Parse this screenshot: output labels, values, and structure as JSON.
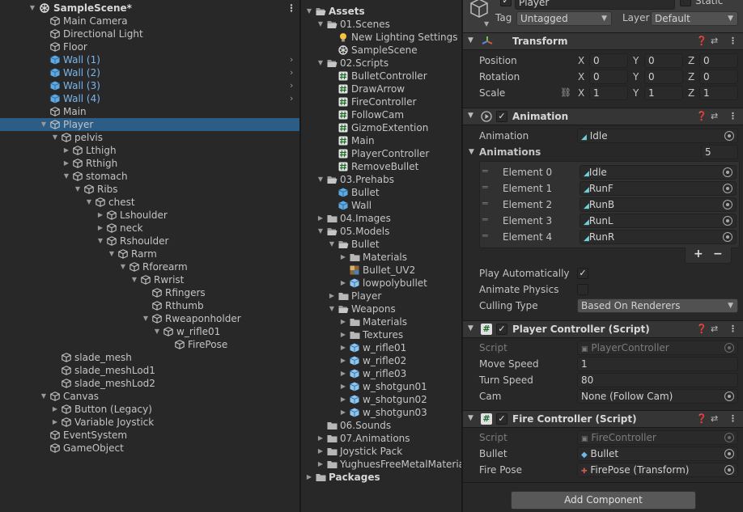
{
  "hierarchy": {
    "scene": "SampleScene*",
    "items": [
      {
        "label": "Main Camera",
        "depth": 1,
        "icon": "gameobject-icon"
      },
      {
        "label": "Directional Light",
        "depth": 1,
        "icon": "gameobject-icon"
      },
      {
        "label": "Floor",
        "depth": 1,
        "icon": "gameobject-icon"
      },
      {
        "label": "Wall (1)",
        "depth": 1,
        "icon": "prefab-icon",
        "prefab": true,
        "chevron": true
      },
      {
        "label": "Wall (2)",
        "depth": 1,
        "icon": "prefab-icon",
        "prefab": true,
        "chevron": true
      },
      {
        "label": "Wall (3)",
        "depth": 1,
        "icon": "prefab-icon",
        "prefab": true,
        "chevron": true
      },
      {
        "label": "Wall (4)",
        "depth": 1,
        "icon": "prefab-icon",
        "prefab": true,
        "chevron": true
      },
      {
        "label": "Main",
        "depth": 1,
        "icon": "gameobject-icon"
      },
      {
        "label": "Player",
        "depth": 1,
        "icon": "gameobject-icon",
        "expanded": true,
        "selected": true
      },
      {
        "label": "pelvis",
        "depth": 2,
        "icon": "gameobject-icon",
        "expanded": true
      },
      {
        "label": "Lthigh",
        "depth": 3,
        "icon": "gameobject-icon",
        "collapsed": true
      },
      {
        "label": "Rthigh",
        "depth": 3,
        "icon": "gameobject-icon",
        "collapsed": true
      },
      {
        "label": "stomach",
        "depth": 3,
        "icon": "gameobject-icon",
        "expanded": true
      },
      {
        "label": "Ribs",
        "depth": 4,
        "icon": "gameobject-icon",
        "expanded": true
      },
      {
        "label": "chest",
        "depth": 5,
        "icon": "gameobject-icon",
        "expanded": true
      },
      {
        "label": "Lshoulder",
        "depth": 6,
        "icon": "gameobject-icon",
        "collapsed": true
      },
      {
        "label": "neck",
        "depth": 6,
        "icon": "gameobject-icon",
        "collapsed": true
      },
      {
        "label": "Rshoulder",
        "depth": 6,
        "icon": "gameobject-icon",
        "expanded": true
      },
      {
        "label": "Rarm",
        "depth": 7,
        "icon": "gameobject-icon",
        "expanded": true
      },
      {
        "label": "Rforearm",
        "depth": 8,
        "icon": "gameobject-icon",
        "expanded": true
      },
      {
        "label": "Rwrist",
        "depth": 9,
        "icon": "gameobject-icon",
        "expanded": true
      },
      {
        "label": "Rfingers",
        "depth": 10,
        "icon": "gameobject-icon"
      },
      {
        "label": "Rthumb",
        "depth": 10,
        "icon": "gameobject-icon"
      },
      {
        "label": "Rweaponholder",
        "depth": 10,
        "icon": "gameobject-icon",
        "expanded": true
      },
      {
        "label": "w_rifle01",
        "depth": 11,
        "icon": "gameobject-icon",
        "expanded": true
      },
      {
        "label": "FirePose",
        "depth": 12,
        "icon": "gameobject-icon"
      },
      {
        "label": "slade_mesh",
        "depth": 2,
        "icon": "gameobject-icon"
      },
      {
        "label": "slade_meshLod1",
        "depth": 2,
        "icon": "gameobject-icon"
      },
      {
        "label": "slade_meshLod2",
        "depth": 2,
        "icon": "gameobject-icon"
      },
      {
        "label": "Canvas",
        "depth": 1,
        "icon": "gameobject-icon",
        "expanded": true
      },
      {
        "label": "Button (Legacy)",
        "depth": 2,
        "icon": "gameobject-icon",
        "collapsed": true
      },
      {
        "label": "Variable Joystick",
        "depth": 2,
        "icon": "gameobject-icon",
        "collapsed": true
      },
      {
        "label": "EventSystem",
        "depth": 1,
        "icon": "gameobject-icon"
      },
      {
        "label": "GameObject",
        "depth": 1,
        "icon": "gameobject-icon"
      }
    ]
  },
  "project": {
    "items": [
      {
        "label": "Assets",
        "depth": 0,
        "icon": "folder-open-icon",
        "expanded": true,
        "bold": true
      },
      {
        "label": "01.Scenes",
        "depth": 1,
        "icon": "folder-open-icon",
        "expanded": true
      },
      {
        "label": "New Lighting Settings",
        "depth": 2,
        "icon": "lighting-icon"
      },
      {
        "label": "SampleScene",
        "depth": 2,
        "icon": "unity-scene-icon"
      },
      {
        "label": "02.Scripts",
        "depth": 1,
        "icon": "folder-open-icon",
        "expanded": true
      },
      {
        "label": "BulletController",
        "depth": 2,
        "icon": "script-icon"
      },
      {
        "label": "DrawArrow",
        "depth": 2,
        "icon": "script-icon"
      },
      {
        "label": "FireController",
        "depth": 2,
        "icon": "script-icon"
      },
      {
        "label": "FollowCam",
        "depth": 2,
        "icon": "script-icon"
      },
      {
        "label": "GizmoExtention",
        "depth": 2,
        "icon": "script-icon"
      },
      {
        "label": "Main",
        "depth": 2,
        "icon": "script-icon"
      },
      {
        "label": "PlayerController",
        "depth": 2,
        "icon": "script-icon"
      },
      {
        "label": "RemoveBullet",
        "depth": 2,
        "icon": "script-icon"
      },
      {
        "label": "03.Prehabs",
        "depth": 1,
        "icon": "folder-open-icon",
        "expanded": true
      },
      {
        "label": "Bullet",
        "depth": 2,
        "icon": "prefab-icon"
      },
      {
        "label": "Wall",
        "depth": 2,
        "icon": "prefab-icon"
      },
      {
        "label": "04.Images",
        "depth": 1,
        "icon": "folder-icon",
        "collapsed": true
      },
      {
        "label": "05.Models",
        "depth": 1,
        "icon": "folder-open-icon",
        "expanded": true
      },
      {
        "label": "Bullet",
        "depth": 2,
        "icon": "folder-open-icon",
        "expanded": true
      },
      {
        "label": "Materials",
        "depth": 3,
        "icon": "folder-icon",
        "collapsed": true
      },
      {
        "label": "Bullet_UV2",
        "depth": 3,
        "icon": "texture-icon"
      },
      {
        "label": "lowpolybullet",
        "depth": 3,
        "icon": "model-icon",
        "collapsed": true
      },
      {
        "label": "Player",
        "depth": 2,
        "icon": "folder-icon",
        "collapsed": true
      },
      {
        "label": "Weapons",
        "depth": 2,
        "icon": "folder-open-icon",
        "expanded": true
      },
      {
        "label": "Materials",
        "depth": 3,
        "icon": "folder-icon",
        "collapsed": true
      },
      {
        "label": "Textures",
        "depth": 3,
        "icon": "folder-icon",
        "collapsed": true
      },
      {
        "label": "w_rifle01",
        "depth": 3,
        "icon": "model-icon",
        "collapsed": true
      },
      {
        "label": "w_rifle02",
        "depth": 3,
        "icon": "model-icon",
        "collapsed": true
      },
      {
        "label": "w_rifle03",
        "depth": 3,
        "icon": "model-icon",
        "collapsed": true
      },
      {
        "label": "w_shotgun01",
        "depth": 3,
        "icon": "model-icon",
        "collapsed": true
      },
      {
        "label": "w_shotgun02",
        "depth": 3,
        "icon": "model-icon",
        "collapsed": true
      },
      {
        "label": "w_shotgun03",
        "depth": 3,
        "icon": "model-icon",
        "collapsed": true
      },
      {
        "label": "06.Sounds",
        "depth": 1,
        "icon": "folder-icon"
      },
      {
        "label": "07.Animations",
        "depth": 1,
        "icon": "folder-icon",
        "collapsed": true
      },
      {
        "label": "Joystick Pack",
        "depth": 1,
        "icon": "folder-icon",
        "collapsed": true
      },
      {
        "label": "YughuesFreeMetalMateria",
        "depth": 1,
        "icon": "folder-icon",
        "collapsed": true
      },
      {
        "label": "Packages",
        "depth": 0,
        "icon": "folder-icon",
        "collapsed": true,
        "bold": true
      }
    ]
  },
  "inspector": {
    "object_name": "Player",
    "static_label": "Static",
    "tag_label": "Tag",
    "tag_value": "Untagged",
    "layer_label": "Layer",
    "layer_value": "Default",
    "transform": {
      "title": "Transform",
      "position_label": "Position",
      "rotation_label": "Rotation",
      "scale_label": "Scale",
      "axis_x": "X",
      "axis_y": "Y",
      "axis_z": "Z",
      "position": [
        "0",
        "0",
        "0"
      ],
      "rotation": [
        "0",
        "0",
        "0"
      ],
      "scale": [
        "1",
        "1",
        "1"
      ]
    },
    "animation": {
      "title": "Animation",
      "animation_label": "Animation",
      "animation_value": "Idle",
      "animations_label": "Animations",
      "animations_count": "5",
      "elements": [
        {
          "label": "Element 0",
          "value": "Idle"
        },
        {
          "label": "Element 1",
          "value": "RunF"
        },
        {
          "label": "Element 2",
          "value": "RunB"
        },
        {
          "label": "Element 3",
          "value": "RunL"
        },
        {
          "label": "Element 4",
          "value": "RunR"
        }
      ],
      "add": "+",
      "remove": "−",
      "play_auto_label": "Play Automatically",
      "animate_physics_label": "Animate Physics",
      "culling_label": "Culling Type",
      "culling_value": "Based On Renderers"
    },
    "player_controller": {
      "title": "Player Controller (Script)",
      "script_label": "Script",
      "script_value": "PlayerController",
      "move_speed_label": "Move Speed",
      "move_speed": "1",
      "turn_speed_label": "Turn Speed",
      "turn_speed": "80",
      "cam_label": "Cam",
      "cam_value": "None (Follow Cam)"
    },
    "fire_controller": {
      "title": "Fire Controller (Script)",
      "script_label": "Script",
      "script_value": "FireController",
      "bullet_label": "Bullet",
      "bullet_value": "Bullet",
      "fire_pose_label": "Fire Pose",
      "fire_pose_value": "FirePose (Transform)"
    },
    "add_component": "Add Component"
  },
  "colors": {
    "selection": "#2c5d87",
    "prefab_text": "#7cb6ef",
    "panel": "#282828"
  }
}
